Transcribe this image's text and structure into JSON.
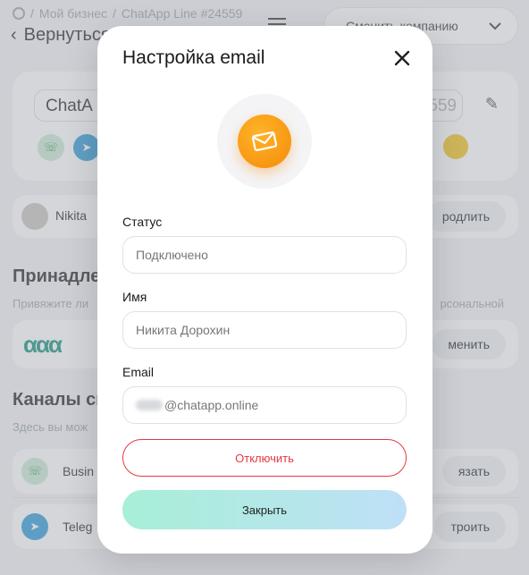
{
  "background": {
    "breadcrumbs": [
      "Мой бизнес",
      "ChatApp Line #24559"
    ],
    "back_label": "Вернуться",
    "company_select_label": "Сменить компанию",
    "line_name": "ChatA",
    "line_id": "559",
    "user_name": "Nikita",
    "prolong_label": "родлить",
    "owner_section_title": "Принадле",
    "owner_section_sub": "Привяжите ли",
    "owner_section_sub_right": "рсональной",
    "change_label": "менить",
    "channels_title": "Каналы св",
    "channels_sub": "Здесь вы мож",
    "channels": [
      {
        "label": "Busin",
        "action": "язать"
      },
      {
        "label": "Teleg",
        "action": "троить"
      }
    ]
  },
  "modal": {
    "title": "Настройка email",
    "status_label": "Статус",
    "status_value": "Подключено",
    "name_label": "Имя",
    "name_value": "Никита Дорохин",
    "email_label": "Email",
    "email_domain": "chatapp.online",
    "disconnect_label": "Отключить",
    "close_label": "Закрыть"
  },
  "colors": {
    "accent_danger": "#e8373f",
    "accent_orange": "#f58a0a",
    "close_gradient_start": "#a7efd7",
    "close_gradient_end": "#bfe0f7"
  },
  "icons": [
    "close-icon",
    "envelope-icon",
    "chevron-down-icon",
    "pencil-icon",
    "telegram-icon",
    "whatsapp-icon",
    "hamburger-icon"
  ]
}
